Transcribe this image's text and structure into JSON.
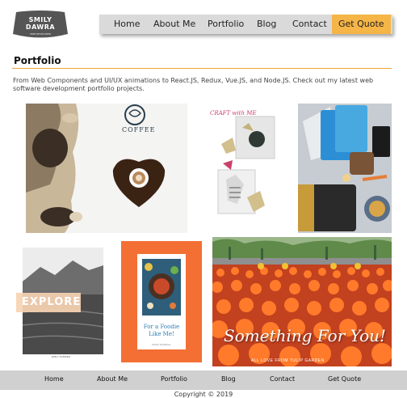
{
  "brand": {
    "logo_line1": "SMILY",
    "logo_line2": "DAWRA",
    "logo_tagline": "WEB DEVELOPER"
  },
  "nav": {
    "items": [
      "Home",
      "About Me",
      "Portfolio",
      "Blog",
      "Contact"
    ],
    "cta": "Get Quote"
  },
  "page": {
    "title": "Portfolio",
    "intro": "From Web Components and UI/UX animations to React.JS, Redux, Vue.JS, and Node.JS. Check out my latest web software development portfolio projects."
  },
  "tiles": {
    "coffee_label": "COFFEE",
    "craft_label": "CRAFT with ME",
    "explore_label": "EXPLORE",
    "explore_caption": "EMILY SOMMER",
    "foodie_label": "For a Foodie Like Me!",
    "foodie_caption": "FOOD JOURNAL",
    "tulip_label": "Something For You!",
    "tulip_caption": "ALL LOVE FROM TULIP GARDEN"
  },
  "footer": {
    "items": [
      "Home",
      "About Me",
      "Portfolio",
      "Blog",
      "Contact",
      "Get Quote"
    ],
    "copyright": "Copyright © 2019"
  },
  "colors": {
    "accent": "#f5b547",
    "rule": "#f0a23a",
    "nav_bg": "#dadada",
    "footer_bg": "#d0d0d0",
    "logo_bg": "#555555",
    "foodie_bg": "#f36f34"
  }
}
